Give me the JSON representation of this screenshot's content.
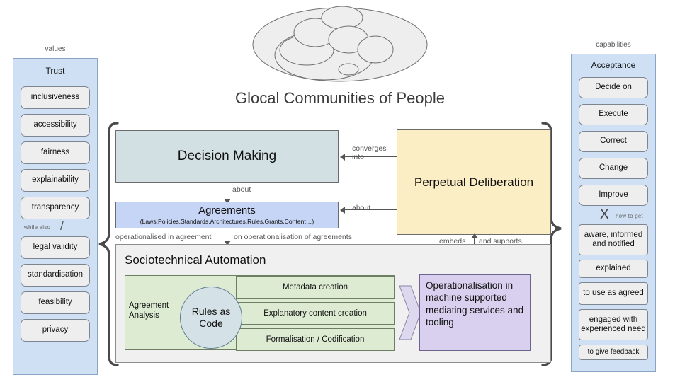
{
  "top": {
    "graphic_name": "glocal-communities-ellipses",
    "title": "Glocal Communities of People"
  },
  "left_panel": {
    "caption": "values",
    "title": "Trust",
    "items_upper": [
      {
        "label": "inclusiveness"
      },
      {
        "label": "accessibility"
      },
      {
        "label": "fairness"
      },
      {
        "label": "explainability"
      },
      {
        "label": "transparency"
      }
    ],
    "connector": {
      "text": "while  also",
      "glyph": "/"
    },
    "items_lower": [
      {
        "label": "legal validity"
      },
      {
        "label": "standardisation"
      },
      {
        "label": "feasibility"
      },
      {
        "label": "privacy"
      }
    ]
  },
  "right_panel": {
    "caption": "capabilities",
    "title": "Acceptance",
    "items_upper": [
      {
        "label": "Decide on"
      },
      {
        "label": "Execute"
      },
      {
        "label": "Correct"
      },
      {
        "label": "Change"
      },
      {
        "label": "Improve"
      }
    ],
    "connector": {
      "glyph": "X",
      "text": "how to get"
    },
    "items_lower": [
      {
        "label": "aware, informed and notified"
      },
      {
        "label": "explained"
      },
      {
        "label": "to use as agreed"
      },
      {
        "label": "engaged with experienced need"
      },
      {
        "label": "to give feedback"
      }
    ]
  },
  "center": {
    "decision_making": "Decision Making",
    "agreements_title": "Agreements",
    "agreements_subtitle": "(Laws,Policies,Standards,Architectures,Rules,Grants,Content…)",
    "perpetual_deliberation": "Perpetual Deliberation",
    "socio_title": "Sociotechnical Automation",
    "agreement_analysis": "Agreement Analysis",
    "rules_as_code": "Rules as Code",
    "green_rows": [
      {
        "label": "Metadata creation"
      },
      {
        "label": "Explanatory content creation"
      },
      {
        "label": "Formalisation / Codification"
      }
    ],
    "operationalisation": "Operationalisation in machine supported mediating services and tooling"
  },
  "edge_labels": {
    "converges_into": "converges into",
    "about_down": "about",
    "about_right": "about",
    "operationalised_in_agreement": "operationalised in agreement",
    "on_operationalisation_of_agreements": "on operationalisation of agreements",
    "embeds": "embeds",
    "and_supports": "and supports"
  },
  "colors": {
    "panel_blue": "#cfe0f4",
    "decision_making": "#d3e0e3",
    "agreements": "#c6d5f5",
    "deliberation": "#fbedc4",
    "green": "#dcebd2",
    "purple": "#d8d0ee",
    "circle": "#d4e2e8",
    "socio_panel": "#f0f0f0"
  }
}
